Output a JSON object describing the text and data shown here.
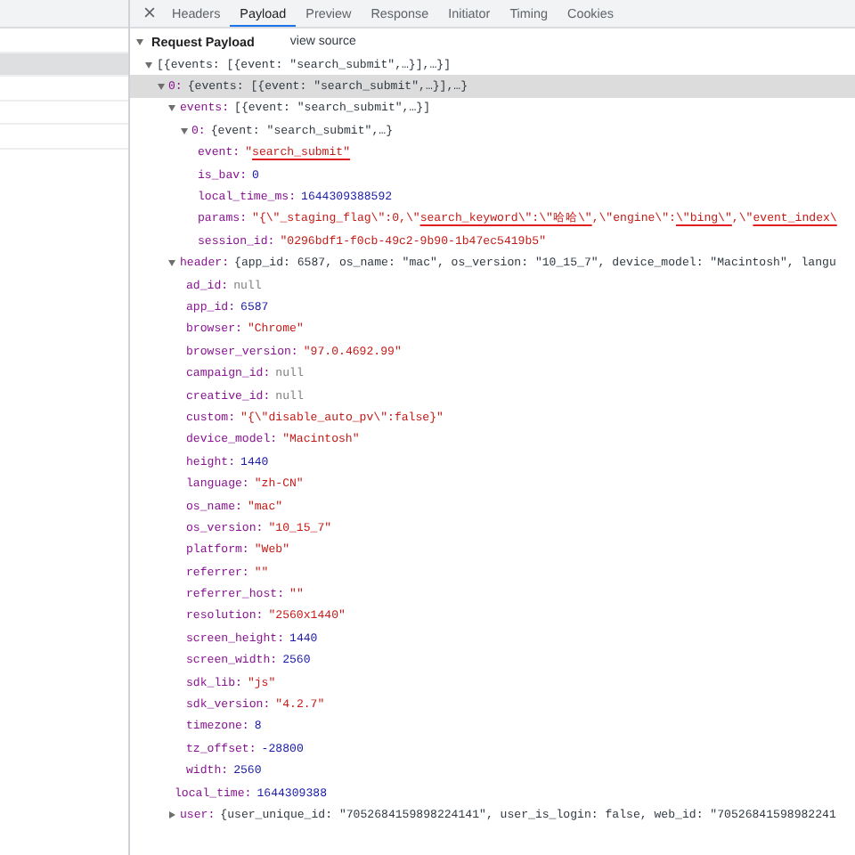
{
  "sidebar": {
    "rows": [
      {
        "selected": false
      },
      {
        "selected": true
      },
      {
        "selected": false
      },
      {
        "selected": false
      },
      {
        "selected": false
      }
    ]
  },
  "tabs": [
    {
      "label": "Headers",
      "selected": false
    },
    {
      "label": "Payload",
      "selected": true
    },
    {
      "label": "Preview",
      "selected": false
    },
    {
      "label": "Response",
      "selected": false
    },
    {
      "label": "Initiator",
      "selected": false
    },
    {
      "label": "Timing",
      "selected": false
    },
    {
      "label": "Cookies",
      "selected": false
    }
  ],
  "section": {
    "title": "Request Payload",
    "expanded": true,
    "link": "view source"
  },
  "tree": [
    {
      "value": "[{events: [{event: \"search_submit\",…}],…}]",
      "kind": "preview",
      "expanded": true,
      "selected": false,
      "children": [
        {
          "key": "0:",
          "value": "{events: [{event: \"search_submit\",…}],…}",
          "kind": "preview",
          "expanded": true,
          "selected": true,
          "children": [
            {
              "key": "events:",
              "value": "[{event: \"search_submit\",…}]",
              "kind": "preview",
              "expanded": true,
              "selected": false,
              "children": [
                {
                  "key": "0:",
                  "value": "{event: \"search_submit\",…}",
                  "kind": "preview",
                  "expanded": true,
                  "selected": false,
                  "children": [
                    {
                      "key": "event:",
                      "kind": "string",
                      "selected": false,
                      "value_parts": [
                        {
                          "text": "\"",
                          "underlined": false
                        },
                        {
                          "text": "search_submit\"",
                          "underlined": true
                        }
                      ]
                    },
                    {
                      "key": "is_bav:",
                      "value": "0",
                      "kind": "number",
                      "selected": false
                    },
                    {
                      "key": "local_time_ms:",
                      "value": "1644309388592",
                      "kind": "number",
                      "selected": false
                    },
                    {
                      "key": "params:",
                      "kind": "string",
                      "selected": false,
                      "value_parts": [
                        {
                          "text": "\"{\\\"_staging_flag\\\":0,\\\"",
                          "underlined": false
                        },
                        {
                          "text": "search_keyword\\\":\\\"哈哈\\\"",
                          "underlined": true
                        },
                        {
                          "text": ",\\\"engine\\\":",
                          "underlined": false
                        },
                        {
                          "text": "\\\"bing\\\"",
                          "underlined": true
                        },
                        {
                          "text": ",\\\"",
                          "underlined": false
                        },
                        {
                          "text": "event_index\\",
                          "underlined": true
                        }
                      ]
                    },
                    {
                      "key": "session_id:",
                      "value": "\"0296bdf1-f0cb-49c2-9b90-1b47ec5419b5\"",
                      "kind": "string",
                      "selected": false
                    }
                  ]
                }
              ]
            },
            {
              "key": "header:",
              "value": "{app_id: 6587, os_name: \"mac\", os_version: \"10_15_7\", device_model: \"Macintosh\", langu",
              "kind": "preview",
              "expanded": true,
              "selected": false,
              "children": [
                {
                  "key": "ad_id:",
                  "value": "null",
                  "kind": "null",
                  "selected": false
                },
                {
                  "key": "app_id:",
                  "value": "6587",
                  "kind": "number",
                  "selected": false
                },
                {
                  "key": "browser:",
                  "value": "\"Chrome\"",
                  "kind": "string",
                  "selected": false
                },
                {
                  "key": "browser_version:",
                  "value": "\"97.0.4692.99\"",
                  "kind": "string",
                  "selected": false
                },
                {
                  "key": "campaign_id:",
                  "value": "null",
                  "kind": "null",
                  "selected": false
                },
                {
                  "key": "creative_id:",
                  "value": "null",
                  "kind": "null",
                  "selected": false
                },
                {
                  "key": "custom:",
                  "value": "\"{\\\"disable_auto_pv\\\":false}\"",
                  "kind": "string",
                  "selected": false
                },
                {
                  "key": "device_model:",
                  "value": "\"Macintosh\"",
                  "kind": "string",
                  "selected": false
                },
                {
                  "key": "height:",
                  "value": "1440",
                  "kind": "number",
                  "selected": false
                },
                {
                  "key": "language:",
                  "value": "\"zh-CN\"",
                  "kind": "string",
                  "selected": false
                },
                {
                  "key": "os_name:",
                  "value": "\"mac\"",
                  "kind": "string",
                  "selected": false
                },
                {
                  "key": "os_version:",
                  "value": "\"10_15_7\"",
                  "kind": "string",
                  "selected": false
                },
                {
                  "key": "platform:",
                  "value": "\"Web\"",
                  "kind": "string",
                  "selected": false
                },
                {
                  "key": "referrer:",
                  "value": "\"\"",
                  "kind": "string",
                  "selected": false
                },
                {
                  "key": "referrer_host:",
                  "value": "\"\"",
                  "kind": "string",
                  "selected": false
                },
                {
                  "key": "resolution:",
                  "value": "\"2560x1440\"",
                  "kind": "string",
                  "selected": false
                },
                {
                  "key": "screen_height:",
                  "value": "1440",
                  "kind": "number",
                  "selected": false
                },
                {
                  "key": "screen_width:",
                  "value": "2560",
                  "kind": "number",
                  "selected": false
                },
                {
                  "key": "sdk_lib:",
                  "value": "\"js\"",
                  "kind": "string",
                  "selected": false
                },
                {
                  "key": "sdk_version:",
                  "value": "\"4.2.7\"",
                  "kind": "string",
                  "selected": false
                },
                {
                  "key": "timezone:",
                  "value": "8",
                  "kind": "number",
                  "selected": false
                },
                {
                  "key": "tz_offset:",
                  "value": "-28800",
                  "kind": "number",
                  "selected": false
                },
                {
                  "key": "width:",
                  "value": "2560",
                  "kind": "number",
                  "selected": false
                }
              ]
            },
            {
              "key": "local_time:",
              "value": "1644309388",
              "kind": "number",
              "selected": false
            },
            {
              "key": "user:",
              "value": "{user_unique_id: \"7052684159898224141\", user_is_login: false, web_id: \"70526841598982241",
              "kind": "preview",
              "expanded": false,
              "selected": false
            }
          ]
        }
      ]
    }
  ]
}
